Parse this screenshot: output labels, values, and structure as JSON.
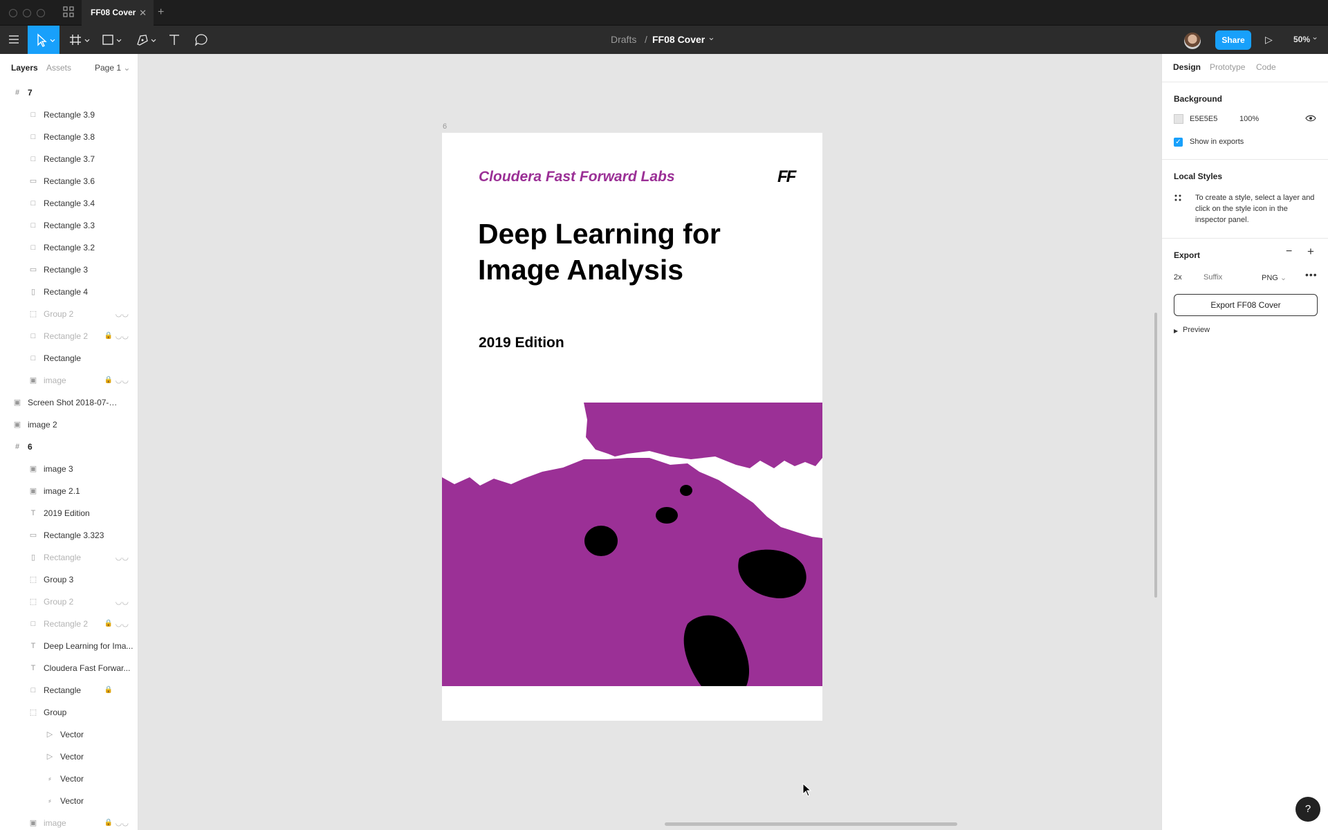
{
  "titlebar": {
    "tab_title": "FF08 Cover",
    "tab_close": "✕",
    "new_tab": "+"
  },
  "toolbar": {
    "breadcrumb_parent": "Drafts",
    "breadcrumb_sep": "/",
    "file_name": "FF08 Cover",
    "file_chevron": "⌄",
    "share_label": "Share",
    "play_icon": "▷",
    "zoom": "50%",
    "zoom_chevron": "⌄"
  },
  "left_panel": {
    "tabs": {
      "layers": "Layers",
      "assets": "Assets",
      "page": "Page 1"
    },
    "layers": [
      {
        "name": "7",
        "icon": "#",
        "indent": 0,
        "kind": "frame"
      },
      {
        "name": "Rectangle 3.9",
        "icon": "□",
        "indent": 1
      },
      {
        "name": "Rectangle 3.8",
        "icon": "□",
        "indent": 1
      },
      {
        "name": "Rectangle 3.7",
        "icon": "□",
        "indent": 1
      },
      {
        "name": "Rectangle 3.6",
        "icon": "▭",
        "indent": 1
      },
      {
        "name": "Rectangle 3.4",
        "icon": "□",
        "indent": 1
      },
      {
        "name": "Rectangle 3.3",
        "icon": "□",
        "indent": 1
      },
      {
        "name": "Rectangle 3.2",
        "icon": "□",
        "indent": 1
      },
      {
        "name": "Rectangle 3",
        "icon": "▭",
        "indent": 1
      },
      {
        "name": "Rectangle 4",
        "icon": "▯",
        "indent": 1
      },
      {
        "name": "Group 2",
        "icon": "⬚",
        "indent": 1,
        "dim": true,
        "hidden": true
      },
      {
        "name": "Rectangle 2",
        "icon": "□",
        "indent": 1,
        "dim": true,
        "locked": true,
        "hidden": true
      },
      {
        "name": "Rectangle",
        "icon": "□",
        "indent": 1
      },
      {
        "name": "image",
        "icon": "▣",
        "indent": 1,
        "dim": true,
        "locked": true,
        "hidden": true
      },
      {
        "name": "Screen Shot 2018-07-17 at...",
        "icon": "▣",
        "indent": 0
      },
      {
        "name": "image 2",
        "icon": "▣",
        "indent": 0
      },
      {
        "name": "6",
        "icon": "#",
        "indent": 0,
        "kind": "frame"
      },
      {
        "name": "image 3",
        "icon": "▣",
        "indent": 1
      },
      {
        "name": "image 2.1",
        "icon": "▣",
        "indent": 1
      },
      {
        "name": "2019 Edition",
        "icon": "T",
        "indent": 1
      },
      {
        "name": "Rectangle 3.323",
        "icon": "▭",
        "indent": 1
      },
      {
        "name": "Rectangle",
        "icon": "▯",
        "indent": 1,
        "dim": true,
        "hidden": true
      },
      {
        "name": "Group 3",
        "icon": "⬚",
        "indent": 1
      },
      {
        "name": "Group 2",
        "icon": "⬚",
        "indent": 1,
        "dim": true,
        "hidden": true
      },
      {
        "name": "Rectangle 2",
        "icon": "□",
        "indent": 1,
        "dim": true,
        "locked": true,
        "hidden": true
      },
      {
        "name": "Deep Learning for Ima...",
        "icon": "T",
        "indent": 1
      },
      {
        "name": "Cloudera Fast Forwar...",
        "icon": "T",
        "indent": 1
      },
      {
        "name": "Rectangle",
        "icon": "□",
        "indent": 1,
        "locked": true
      },
      {
        "name": "Group",
        "icon": "⬚",
        "indent": 1
      },
      {
        "name": "Vector",
        "icon": "▷",
        "indent": 2
      },
      {
        "name": "Vector",
        "icon": "▷",
        "indent": 2
      },
      {
        "name": "Vector",
        "icon": "⸗",
        "indent": 2
      },
      {
        "name": "Vector",
        "icon": "⸗",
        "indent": 2
      },
      {
        "name": "image",
        "icon": "▣",
        "indent": 1,
        "dim": true,
        "locked": true,
        "hidden": true
      }
    ]
  },
  "canvas": {
    "frame_label": "6",
    "brand": "Cloudera Fast Forward Labs",
    "logo": "FF",
    "title": "Deep Learning for Image Analysis",
    "edition": "2019 Edition",
    "accent_color": "#9b3096"
  },
  "right_panel": {
    "tabs": {
      "design": "Design",
      "prototype": "Prototype",
      "code": "Code"
    },
    "background": {
      "title": "Background",
      "hex": "E5E5E5",
      "opacity": "100%",
      "show_in_exports": "Show in exports"
    },
    "local_styles": {
      "title": "Local Styles",
      "hint": "To create a style, select a layer and click on the style icon in the inspector panel."
    },
    "export": {
      "title": "Export",
      "scale": "2x",
      "suffix_placeholder": "Suffix",
      "format": "PNG",
      "button": "Export FF08 Cover",
      "preview": "Preview"
    }
  },
  "help_label": "?"
}
